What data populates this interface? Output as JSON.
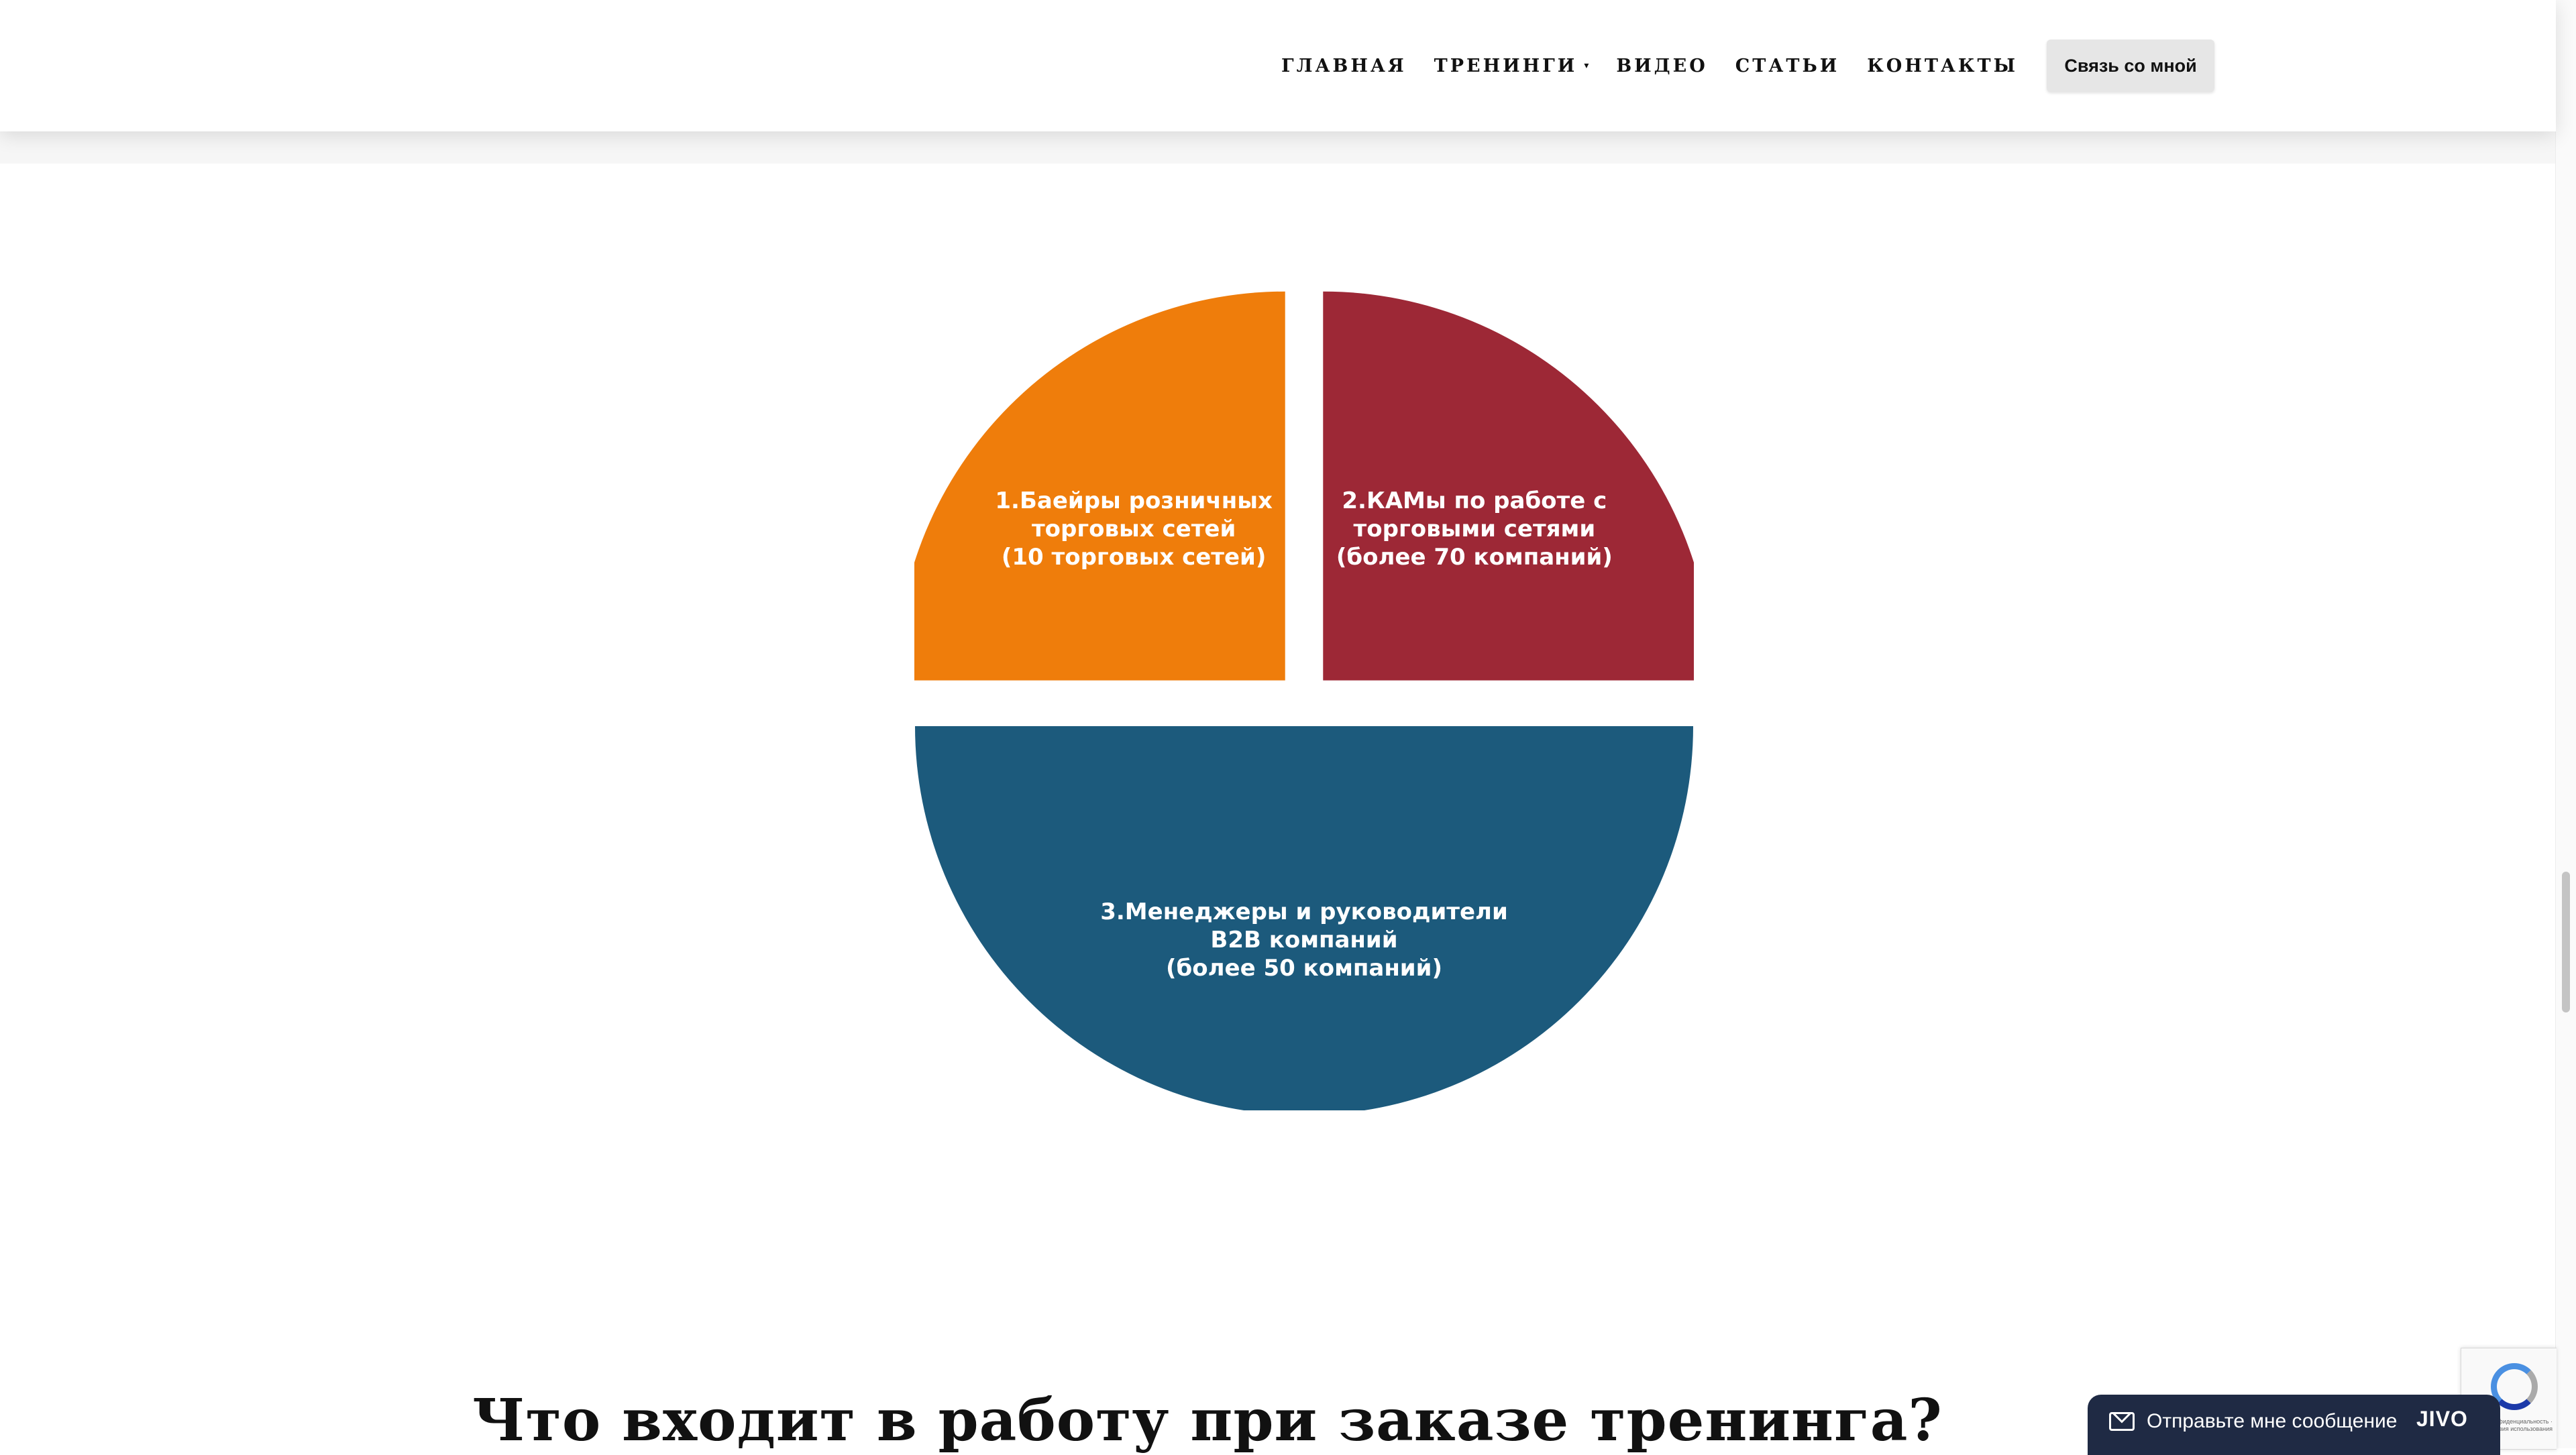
{
  "nav": {
    "items": [
      {
        "label": "ГЛАВНАЯ",
        "has_dropdown": false
      },
      {
        "label": "ТРЕНИНГИ",
        "has_dropdown": true
      },
      {
        "label": "ВИДЕО",
        "has_dropdown": false
      },
      {
        "label": "СТАТЬИ",
        "has_dropdown": false
      },
      {
        "label": "КОНТАКТЫ",
        "has_dropdown": false
      }
    ],
    "dropdown_caret": "▾",
    "contact_button": "Связь со мной"
  },
  "chart_data": {
    "type": "pie",
    "segments": [
      {
        "label": "1.Баейры розничных\nторговых сетей\n(10 торговых сетей)",
        "value": 25,
        "color": "#ef7d0b"
      },
      {
        "label": "2.КАМы по работе с\nторговыми сетями\n(более 70 компаний)",
        "value": 25,
        "color": "#9d2836"
      },
      {
        "label": "3.Менеджеры и руководители\nB2B компаний\n(более 50 компаний)",
        "value": 50,
        "color": "#1c5a7c"
      }
    ]
  },
  "heading": "Что входит в работу при заказе тренинга?",
  "chat_widget": {
    "text": "Отправьте мне сообщение",
    "logo": "JIVO",
    "icon": "mail-icon"
  },
  "recaptcha": {
    "text": "Конфиденциальность · Условия использования",
    "icon": "recaptcha-icon"
  }
}
